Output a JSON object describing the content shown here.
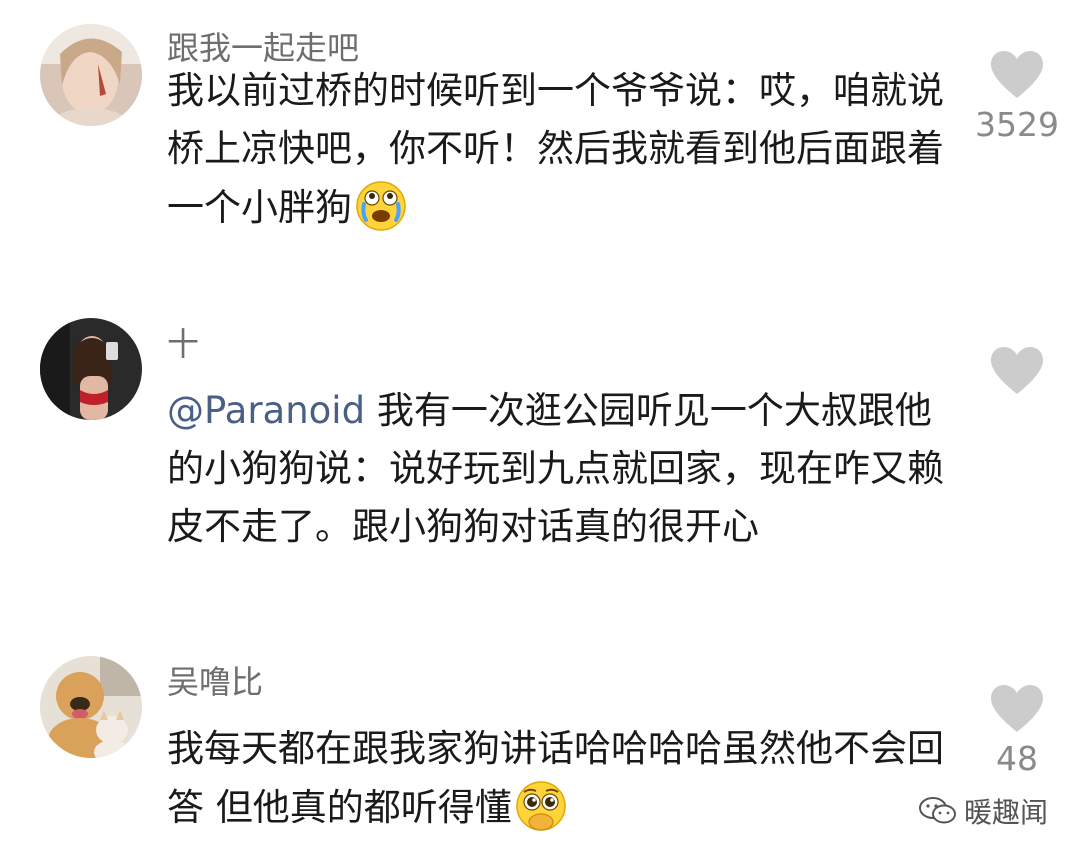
{
  "comments": [
    {
      "username": "跟我一起走吧",
      "mention": "",
      "text": "我以前过桥的时候听到一个爷爷说：哎，咱就说桥上凉快吧，你不听！然后我就看到他后面跟着一个小胖狗",
      "emoji": "crying-face-emoji",
      "likes": "3529"
    },
    {
      "username": "十",
      "mention": "@Paranoid",
      "text": " 我有一次逛公园听见一个大叔跟他的小狗狗说：说好玩到九点就回家，现在咋又赖皮不走了。跟小狗狗对话真的很开心",
      "emoji": "",
      "likes": ""
    },
    {
      "username": "吴噜比",
      "mention": "",
      "text": "我每天都在跟我家狗讲话哈哈哈哈虽然他不会回答 但他真的都听得懂",
      "emoji": "pleading-face-emoji",
      "likes": "48"
    }
  ],
  "icons": {
    "like": "heart-icon",
    "watermark": "wechat-icon"
  },
  "watermark": {
    "text": "暖趣闻"
  },
  "colors": {
    "background": "#ffffff",
    "text": "#1a1a1a",
    "username": "#6e6e6e",
    "mention": "#4a5f86",
    "heart": "#cccccc",
    "like_count": "#8a8a8a"
  }
}
